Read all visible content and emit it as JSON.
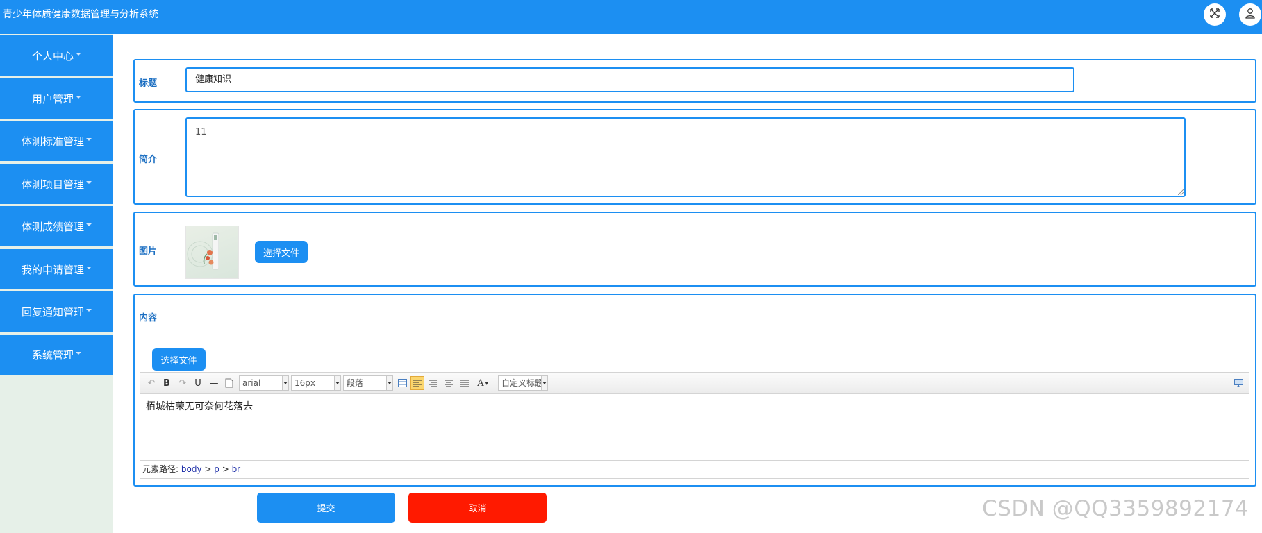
{
  "app": {
    "title": "青少年体质健康数据管理与分析系统"
  },
  "header": {
    "fullscreen_icon": "expand-arrows-icon",
    "user_icon": "user-icon"
  },
  "sidebar": {
    "items": [
      {
        "label": "个人中心"
      },
      {
        "label": "用户管理"
      },
      {
        "label": "体测标准管理"
      },
      {
        "label": "体测项目管理"
      },
      {
        "label": "体测成绩管理"
      },
      {
        "label": "我的申请管理"
      },
      {
        "label": "回复通知管理"
      },
      {
        "label": "系统管理"
      }
    ]
  },
  "form": {
    "title_label": "标题",
    "title_value": "健康知识",
    "intro_label": "简介",
    "intro_value": "11",
    "image_label": "图片",
    "image_button": "选择文件",
    "content_label": "内容",
    "content_upload_button": "选择文件"
  },
  "editor": {
    "font_family": "arial",
    "font_size": "16px",
    "paragraph": "段落",
    "custom_title": "自定义标题",
    "body_text": "栢城枯荣无可奈何花落去",
    "path_label": "元素路径:",
    "path": [
      "body",
      "p",
      "br"
    ]
  },
  "actions": {
    "submit": "提交",
    "cancel": "取消"
  },
  "watermark": "CSDN @QQ3359892174",
  "colors": {
    "primary": "#1c8ff2",
    "danger": "#ff1a00",
    "sidebar_bg": "#e6f0e8"
  }
}
